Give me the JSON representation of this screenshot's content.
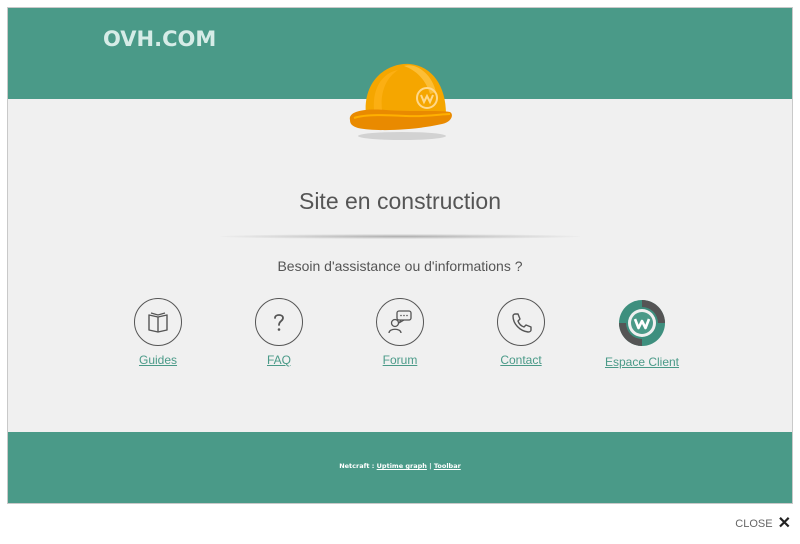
{
  "header": {
    "logo_text": "OVH.COM"
  },
  "main": {
    "title": "Site en construction",
    "subtitle": "Besoin d'assistance ou d'informations ?",
    "links": [
      {
        "label": "Guides",
        "icon": "book-icon"
      },
      {
        "label": "FAQ",
        "icon": "question-icon"
      },
      {
        "label": "Forum",
        "icon": "forum-icon"
      },
      {
        "label": "Contact",
        "icon": "phone-icon"
      },
      {
        "label": "Espace Client",
        "icon": "ovh-client-icon"
      }
    ]
  },
  "footer": {
    "prefix": "Netcraft :",
    "uptime_link": "Uptime graph",
    "separator": "|",
    "toolbar_link": "Toolbar"
  },
  "overlay": {
    "close_label": "CLOSE"
  },
  "colors": {
    "brand": "#4a9a88",
    "helmet": "#f5a300",
    "background": "#f0f0f0"
  }
}
